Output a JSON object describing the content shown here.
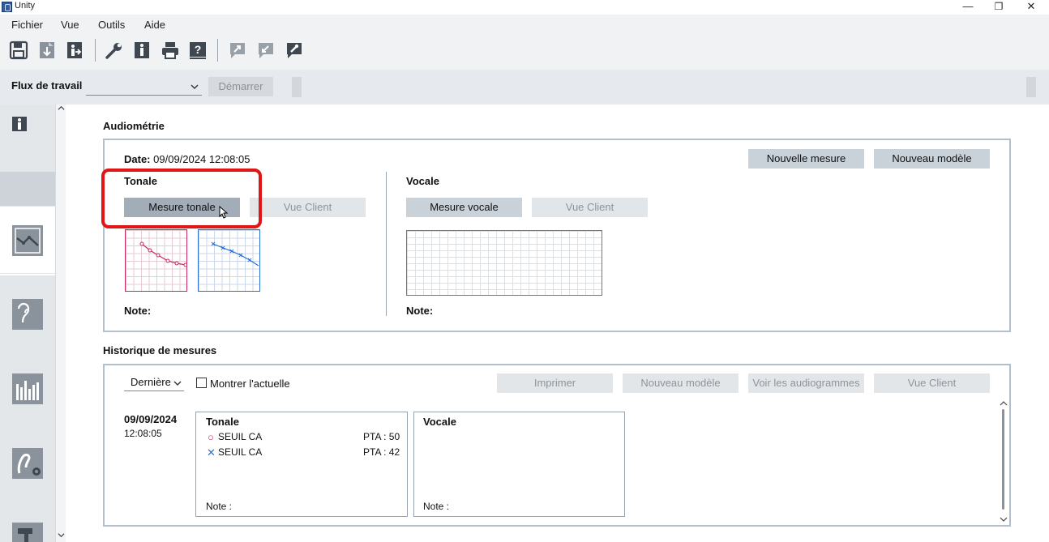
{
  "window": {
    "title": "Unity",
    "minimize": "—",
    "restore": "❐",
    "close": "✕"
  },
  "menu": [
    "Fichier",
    "Vue",
    "Outils",
    "Aide"
  ],
  "toolbar": {
    "icons": [
      "save-icon",
      "import-icon",
      "export-client-icon",
      "wrench-icon",
      "client-info-icon",
      "print-icon",
      "help-icon",
      "send-icon",
      "receive-icon",
      "connect-icon"
    ]
  },
  "workflow": {
    "label": "Flux de travail",
    "selected": "",
    "start_label": "Démarrer"
  },
  "sidebar": {
    "items": [
      "client-icon",
      "audiogram-icon",
      "ear-icon",
      "bar-graph-icon",
      "hearing-aid-settings-icon",
      "tools-icon"
    ]
  },
  "audiometry": {
    "title": "Audiométrie",
    "date_label": "Date:",
    "date_value": "09/09/2024 12:08:05",
    "new_measure": "Nouvelle mesure",
    "new_model": "Nouveau modèle",
    "tonal": {
      "title": "Tonale",
      "measure_button": "Mesure tonale",
      "client_view": "Vue Client",
      "note_label": "Note:"
    },
    "vocal": {
      "title": "Vocale",
      "measure_button": "Mesure vocale",
      "client_view": "Vue Client",
      "note_label": "Note:"
    }
  },
  "history": {
    "title": "Historique de mesures",
    "filter": "Dernière",
    "show_current": "Montrer l'actuelle",
    "print": "Imprimer",
    "new_model": "Nouveau modèle",
    "view_audiograms": "Voir les audiogrammes",
    "client_view": "Vue Client",
    "entry": {
      "date": "09/09/2024",
      "time": "12:08:05",
      "tonal": {
        "title": "Tonale",
        "rows": [
          {
            "symbol": "○",
            "label": "SEUIL CA",
            "pta": "PTA : 50"
          },
          {
            "symbol": "✕",
            "label": "SEUIL CA",
            "pta": "PTA : 42"
          }
        ],
        "note": "Note :"
      },
      "vocal": {
        "title": "Vocale",
        "note": "Note :"
      }
    }
  },
  "colors": {
    "right_ear": "#c9285e",
    "left_ear": "#2a6fd6",
    "highlight": "#e01515"
  }
}
